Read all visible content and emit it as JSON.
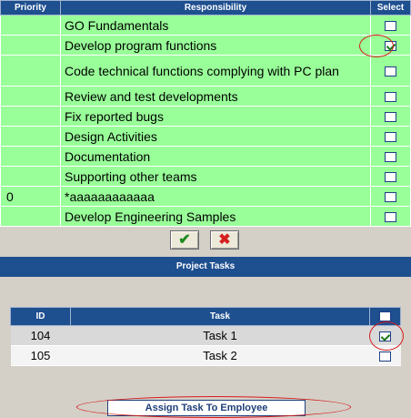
{
  "responsibility_table": {
    "headers": {
      "priority": "Priority",
      "responsibility": "Responsibility",
      "select": "Select"
    },
    "rows": [
      {
        "priority": "",
        "responsibility": "GO Fundamentals",
        "checked": false
      },
      {
        "priority": "",
        "responsibility": "Develop program functions",
        "checked": true
      },
      {
        "priority": "",
        "responsibility": "Code technical functions complying with PC plan",
        "checked": false
      },
      {
        "priority": "",
        "responsibility": "Review and test developments",
        "checked": false
      },
      {
        "priority": "",
        "responsibility": "Fix reported bugs",
        "checked": false
      },
      {
        "priority": "",
        "responsibility": "Design Activities",
        "checked": false
      },
      {
        "priority": "",
        "responsibility": "Documentation",
        "checked": false
      },
      {
        "priority": "",
        "responsibility": "Supporting other teams",
        "checked": false
      },
      {
        "priority": "0",
        "responsibility": "*aaaaaaaaaaaa",
        "checked": false
      },
      {
        "priority": "",
        "responsibility": "Develop Engineering Samples",
        "checked": false
      }
    ]
  },
  "actions": {
    "ok_icon": "checkmark-icon",
    "cancel_icon": "x-icon"
  },
  "project_tasks": {
    "title": "Project Tasks",
    "headers": {
      "id": "ID",
      "task": "Task"
    },
    "select_all_checked": false,
    "rows": [
      {
        "id": "104",
        "task": "Task 1",
        "checked": true
      },
      {
        "id": "105",
        "task": "Task 2",
        "checked": false
      }
    ],
    "assign_button": "Assign Task To Employee"
  },
  "colors": {
    "header_bg": "#1e4f8f",
    "row_green": "#99ff99",
    "annotation_red": "#d81b1b"
  }
}
